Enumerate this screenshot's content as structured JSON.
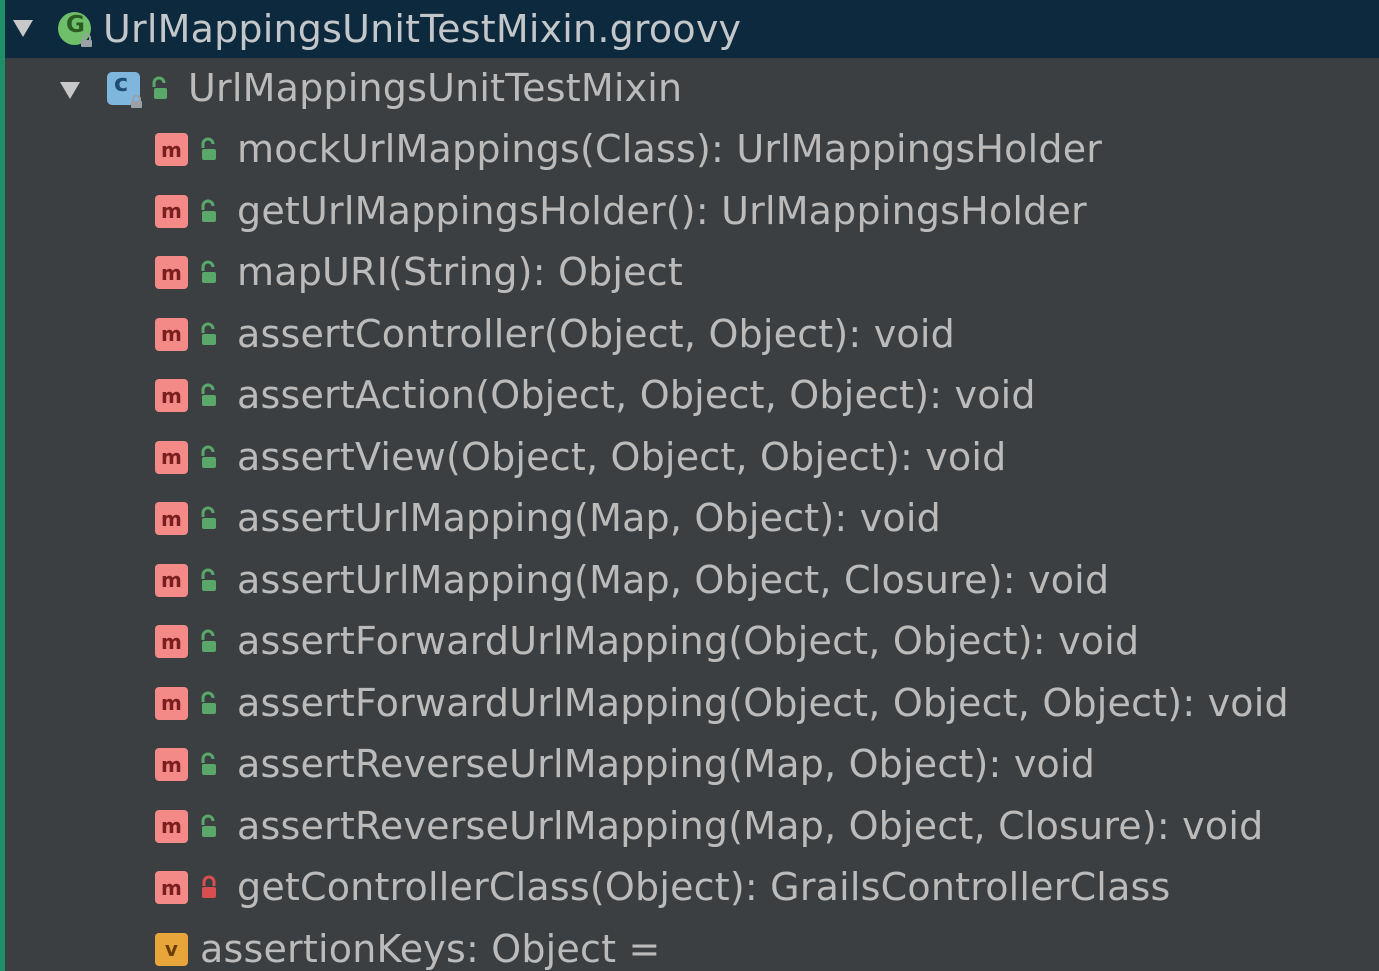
{
  "colors": {
    "background": "#3c3f41",
    "selected_row": "#0d293e",
    "text": "#bbbbbb",
    "method_icon": "#f38a87",
    "variable_icon": "#e8a53a",
    "class_icon": "#7fb6de",
    "groovy_icon": "#6fbf6a",
    "public_lock": "#59a869",
    "private_lock": "#d94f4f"
  },
  "file": {
    "name": "UrlMappingsUnitTestMixin.groovy",
    "icon": "groovy-file-icon"
  },
  "class": {
    "name": "UrlMappingsUnitTestMixin",
    "icon": "class-icon"
  },
  "members": [
    {
      "label": "mockUrlMappings(Class): UrlMappingsHolder",
      "kind": "method",
      "visibility": "public"
    },
    {
      "label": "getUrlMappingsHolder(): UrlMappingsHolder",
      "kind": "method",
      "visibility": "public"
    },
    {
      "label": "mapURI(String): Object",
      "kind": "method",
      "visibility": "public"
    },
    {
      "label": "assertController(Object, Object): void",
      "kind": "method",
      "visibility": "public"
    },
    {
      "label": "assertAction(Object, Object, Object): void",
      "kind": "method",
      "visibility": "public"
    },
    {
      "label": "assertView(Object, Object, Object): void",
      "kind": "method",
      "visibility": "public"
    },
    {
      "label": "assertUrlMapping(Map, Object): void",
      "kind": "method",
      "visibility": "public"
    },
    {
      "label": "assertUrlMapping(Map, Object, Closure): void",
      "kind": "method",
      "visibility": "public"
    },
    {
      "label": "assertForwardUrlMapping(Object, Object): void",
      "kind": "method",
      "visibility": "public"
    },
    {
      "label": "assertForwardUrlMapping(Object, Object, Object): void",
      "kind": "method",
      "visibility": "public"
    },
    {
      "label": "assertReverseUrlMapping(Map, Object): void",
      "kind": "method",
      "visibility": "public"
    },
    {
      "label": "assertReverseUrlMapping(Map, Object, Closure): void",
      "kind": "method",
      "visibility": "public"
    },
    {
      "label": "getControllerClass(Object): GrailsControllerClass",
      "kind": "method",
      "visibility": "private"
    },
    {
      "label": "assertionKeys: Object =",
      "kind": "variable",
      "visibility": "none"
    }
  ]
}
